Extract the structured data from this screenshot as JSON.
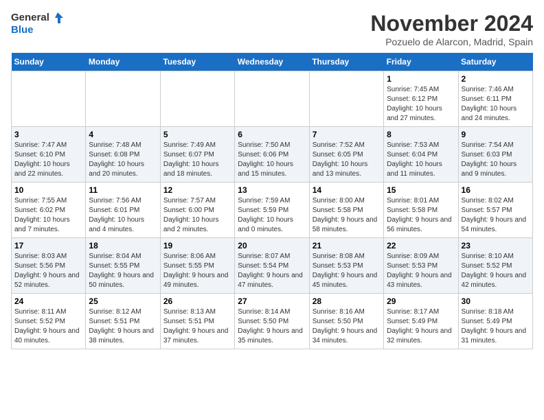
{
  "header": {
    "logo_general": "General",
    "logo_blue": "Blue",
    "title": "November 2024",
    "subtitle": "Pozuelo de Alarcon, Madrid, Spain"
  },
  "days_of_week": [
    "Sunday",
    "Monday",
    "Tuesday",
    "Wednesday",
    "Thursday",
    "Friday",
    "Saturday"
  ],
  "weeks": [
    [
      {
        "day": "",
        "info": ""
      },
      {
        "day": "",
        "info": ""
      },
      {
        "day": "",
        "info": ""
      },
      {
        "day": "",
        "info": ""
      },
      {
        "day": "",
        "info": ""
      },
      {
        "day": "1",
        "info": "Sunrise: 7:45 AM\nSunset: 6:12 PM\nDaylight: 10 hours and 27 minutes."
      },
      {
        "day": "2",
        "info": "Sunrise: 7:46 AM\nSunset: 6:11 PM\nDaylight: 10 hours and 24 minutes."
      }
    ],
    [
      {
        "day": "3",
        "info": "Sunrise: 7:47 AM\nSunset: 6:10 PM\nDaylight: 10 hours and 22 minutes."
      },
      {
        "day": "4",
        "info": "Sunrise: 7:48 AM\nSunset: 6:08 PM\nDaylight: 10 hours and 20 minutes."
      },
      {
        "day": "5",
        "info": "Sunrise: 7:49 AM\nSunset: 6:07 PM\nDaylight: 10 hours and 18 minutes."
      },
      {
        "day": "6",
        "info": "Sunrise: 7:50 AM\nSunset: 6:06 PM\nDaylight: 10 hours and 15 minutes."
      },
      {
        "day": "7",
        "info": "Sunrise: 7:52 AM\nSunset: 6:05 PM\nDaylight: 10 hours and 13 minutes."
      },
      {
        "day": "8",
        "info": "Sunrise: 7:53 AM\nSunset: 6:04 PM\nDaylight: 10 hours and 11 minutes."
      },
      {
        "day": "9",
        "info": "Sunrise: 7:54 AM\nSunset: 6:03 PM\nDaylight: 10 hours and 9 minutes."
      }
    ],
    [
      {
        "day": "10",
        "info": "Sunrise: 7:55 AM\nSunset: 6:02 PM\nDaylight: 10 hours and 7 minutes."
      },
      {
        "day": "11",
        "info": "Sunrise: 7:56 AM\nSunset: 6:01 PM\nDaylight: 10 hours and 4 minutes."
      },
      {
        "day": "12",
        "info": "Sunrise: 7:57 AM\nSunset: 6:00 PM\nDaylight: 10 hours and 2 minutes."
      },
      {
        "day": "13",
        "info": "Sunrise: 7:59 AM\nSunset: 5:59 PM\nDaylight: 10 hours and 0 minutes."
      },
      {
        "day": "14",
        "info": "Sunrise: 8:00 AM\nSunset: 5:58 PM\nDaylight: 9 hours and 58 minutes."
      },
      {
        "day": "15",
        "info": "Sunrise: 8:01 AM\nSunset: 5:58 PM\nDaylight: 9 hours and 56 minutes."
      },
      {
        "day": "16",
        "info": "Sunrise: 8:02 AM\nSunset: 5:57 PM\nDaylight: 9 hours and 54 minutes."
      }
    ],
    [
      {
        "day": "17",
        "info": "Sunrise: 8:03 AM\nSunset: 5:56 PM\nDaylight: 9 hours and 52 minutes."
      },
      {
        "day": "18",
        "info": "Sunrise: 8:04 AM\nSunset: 5:55 PM\nDaylight: 9 hours and 50 minutes."
      },
      {
        "day": "19",
        "info": "Sunrise: 8:06 AM\nSunset: 5:55 PM\nDaylight: 9 hours and 49 minutes."
      },
      {
        "day": "20",
        "info": "Sunrise: 8:07 AM\nSunset: 5:54 PM\nDaylight: 9 hours and 47 minutes."
      },
      {
        "day": "21",
        "info": "Sunrise: 8:08 AM\nSunset: 5:53 PM\nDaylight: 9 hours and 45 minutes."
      },
      {
        "day": "22",
        "info": "Sunrise: 8:09 AM\nSunset: 5:53 PM\nDaylight: 9 hours and 43 minutes."
      },
      {
        "day": "23",
        "info": "Sunrise: 8:10 AM\nSunset: 5:52 PM\nDaylight: 9 hours and 42 minutes."
      }
    ],
    [
      {
        "day": "24",
        "info": "Sunrise: 8:11 AM\nSunset: 5:52 PM\nDaylight: 9 hours and 40 minutes."
      },
      {
        "day": "25",
        "info": "Sunrise: 8:12 AM\nSunset: 5:51 PM\nDaylight: 9 hours and 38 minutes."
      },
      {
        "day": "26",
        "info": "Sunrise: 8:13 AM\nSunset: 5:51 PM\nDaylight: 9 hours and 37 minutes."
      },
      {
        "day": "27",
        "info": "Sunrise: 8:14 AM\nSunset: 5:50 PM\nDaylight: 9 hours and 35 minutes."
      },
      {
        "day": "28",
        "info": "Sunrise: 8:16 AM\nSunset: 5:50 PM\nDaylight: 9 hours and 34 minutes."
      },
      {
        "day": "29",
        "info": "Sunrise: 8:17 AM\nSunset: 5:49 PM\nDaylight: 9 hours and 32 minutes."
      },
      {
        "day": "30",
        "info": "Sunrise: 8:18 AM\nSunset: 5:49 PM\nDaylight: 9 hours and 31 minutes."
      }
    ]
  ]
}
